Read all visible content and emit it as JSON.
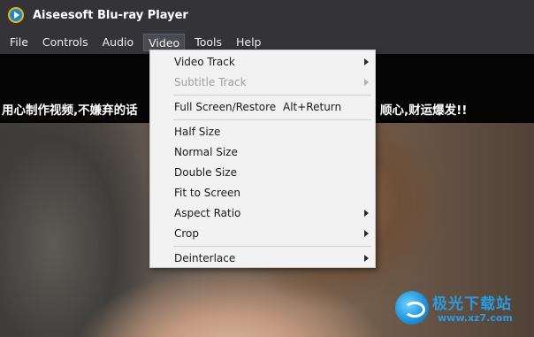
{
  "app": {
    "title": "Aiseesoft Blu-ray Player"
  },
  "menubar": {
    "file": "File",
    "controls": "Controls",
    "audio": "Audio",
    "video": "Video",
    "tools": "Tools",
    "help": "Help"
  },
  "video_menu": {
    "video_track": "Video Track",
    "subtitle_track": "Subtitle Track",
    "full_screen": "Full Screen/Restore",
    "full_screen_shortcut": "Alt+Return",
    "half_size": "Half Size",
    "normal_size": "Normal Size",
    "double_size": "Double Size",
    "fit_to_screen": "Fit to Screen",
    "aspect_ratio": "Aspect Ratio",
    "crop": "Crop",
    "deinterlace": "Deinterlace"
  },
  "video": {
    "subtitle_left": "用心制作视频,不嫌弃的话",
    "subtitle_right": "顺心,财运爆发!!"
  },
  "watermark": {
    "brand": "极光下载站",
    "url": "www.xz7.com"
  }
}
